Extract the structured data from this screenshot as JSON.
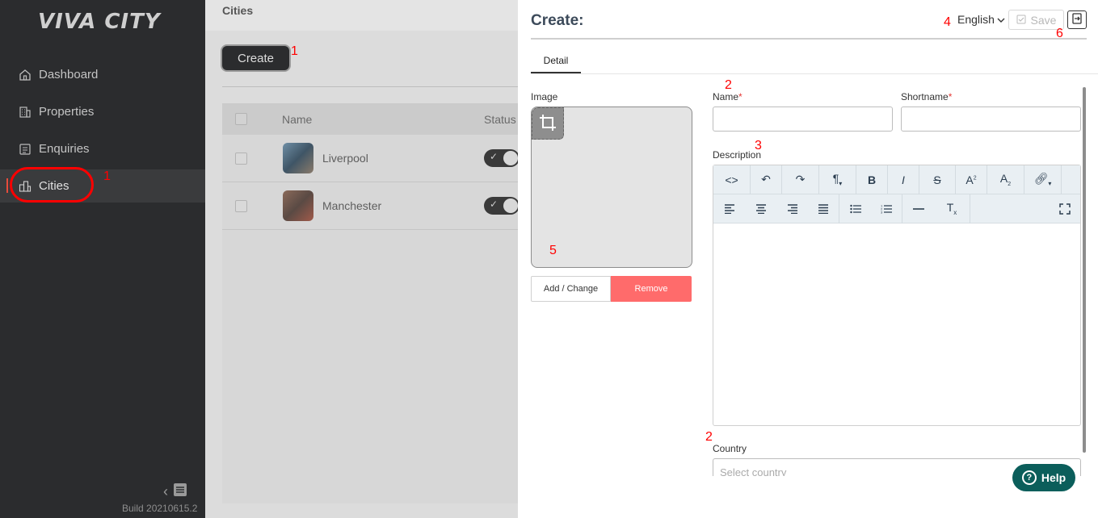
{
  "sidebar": {
    "logo": "VIVA CITY",
    "items": [
      {
        "label": "Dashboard",
        "icon": "home-icon"
      },
      {
        "label": "Properties",
        "icon": "building-icon"
      },
      {
        "label": "Enquiries",
        "icon": "list-icon"
      },
      {
        "label": "Cities",
        "icon": "city-icon",
        "active": true
      }
    ],
    "build": "Build 20210615.2"
  },
  "main": {
    "title": "Cities",
    "create_label": "Create",
    "table": {
      "headers": [
        "Name",
        "Status"
      ],
      "rows": [
        {
          "name": "Liverpool",
          "status": true
        },
        {
          "name": "Manchester",
          "status": true
        }
      ]
    }
  },
  "panel": {
    "title": "Create:",
    "language": "English",
    "save_label": "Save",
    "tab_detail": "Detail",
    "image_label": "Image",
    "add_change_label": "Add / Change",
    "remove_label": "Remove",
    "name_label": "Name",
    "shortname_label": "Shortname",
    "description_label": "Description",
    "country_label": "Country",
    "country_placeholder": "Select country"
  },
  "annotations": {
    "a1_sidebar": "1",
    "a1_create": "1",
    "a2_name": "2",
    "a2_country": "2",
    "a3": "3",
    "a4": "4",
    "a5": "5",
    "a6": "6"
  },
  "help_label": "Help",
  "colors": {
    "sidebar_bg": "#2b2c2e",
    "remove_bg": "#ff6b6b",
    "help_bg": "#0b5e5b",
    "annotation": "#ff0000"
  }
}
